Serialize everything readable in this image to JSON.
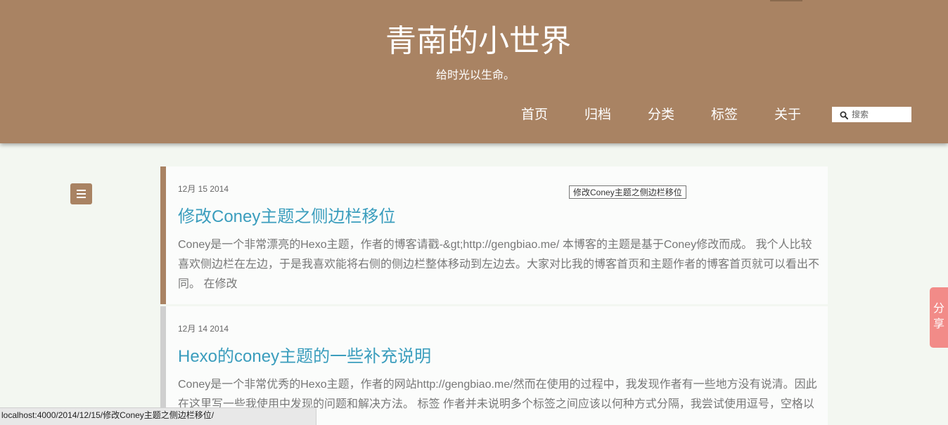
{
  "site": {
    "title": "青南的小世界",
    "subtitle": "给时光以生命。"
  },
  "nav": {
    "items": [
      {
        "label": "首页"
      },
      {
        "label": "归档"
      },
      {
        "label": "分类"
      },
      {
        "label": "标签"
      },
      {
        "label": "关于"
      }
    ]
  },
  "search": {
    "placeholder": "搜索"
  },
  "posts": [
    {
      "date": "12月 15 2014",
      "title": "修改Coney主题之侧边栏移位",
      "excerpt": "Coney是一个非常漂亮的Hexo主题，作者的博客请戳-&gt;http://gengbiao.me/ 本博客的主题是基于Coney修改而成。 我个人比较喜欢侧边栏在左边，于是我喜欢能将右侧的侧边栏整体移动到左边去。大家对比我的博客首页和主题作者的博客首页就可以看出不同。 在修改"
    },
    {
      "date": "12月 14 2014",
      "title": "Hexo的coney主题的一些补充说明",
      "excerpt": "Coney是一个非常优秀的Hexo主题，作者的网站http://gengbiao.me/然而在使用的过程中，我发现作者有一些地方没有说清。因此在这里写一些我使用中发现的问题和解决方法。 标签 作者并未说明多个标签之间应该以何种方式分隔，我尝试使用逗号，空格以"
    }
  ],
  "tooltip": {
    "text": "修改Coney主题之侧边栏移位"
  },
  "share": {
    "label": "分享"
  },
  "status_bar": {
    "url": "localhost:4000/2014/12/15/修改Coney主题之侧边栏移位/"
  },
  "colors": {
    "header": "#a98363",
    "link": "#3a9dbd",
    "share": "#f28b88",
    "active_post_border": "#a98363",
    "post_border": "#cfcfcf"
  },
  "icons": {
    "menu": "menu-icon",
    "search": "search-icon"
  }
}
